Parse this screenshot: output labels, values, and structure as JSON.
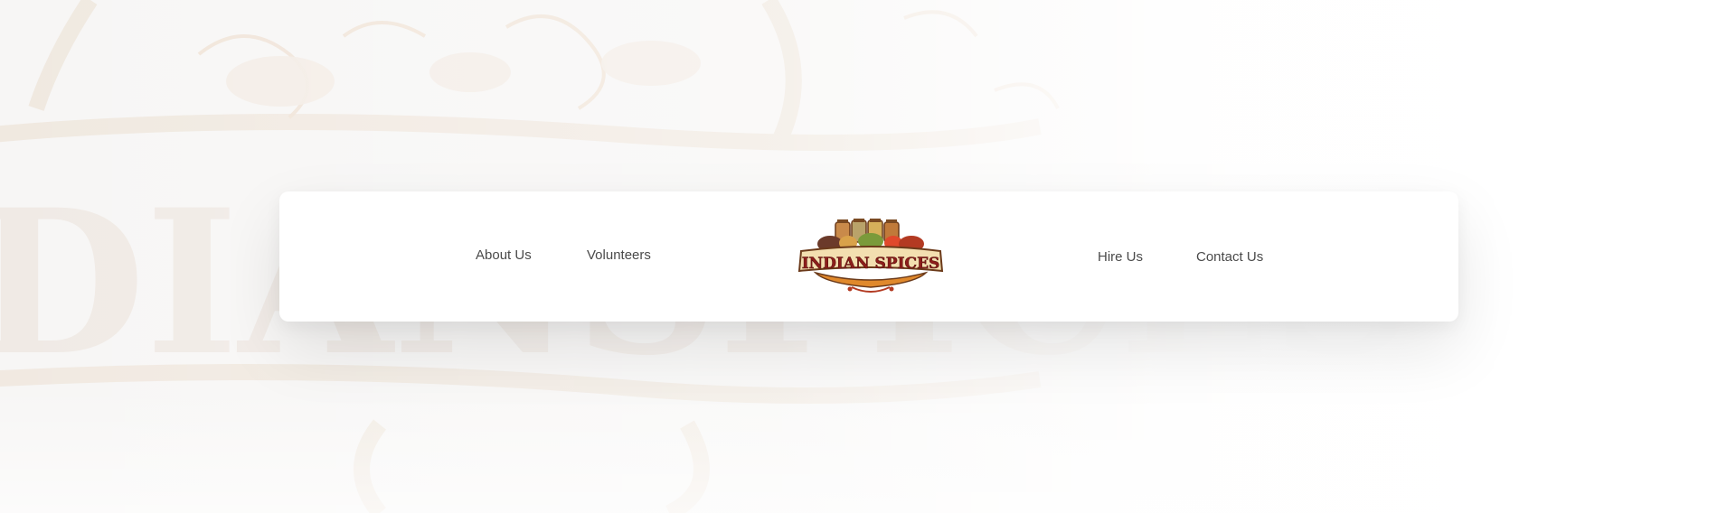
{
  "nav": {
    "left_links": [
      {
        "label": "About Us"
      },
      {
        "label": "Volunteers"
      }
    ],
    "right_links": [
      {
        "label": "Hire Us"
      },
      {
        "label": "Contact Us"
      }
    ]
  },
  "logo": {
    "text": "INDIAN SPICES",
    "icon": "spice-jars-logo"
  },
  "colors": {
    "background": "#f7f6f5",
    "navbar": "#ffffff",
    "link_text": "#4a4a4a",
    "logo_red": "#8e1d1b",
    "logo_orange": "#e0892c",
    "logo_cream": "#f3dfb0"
  }
}
